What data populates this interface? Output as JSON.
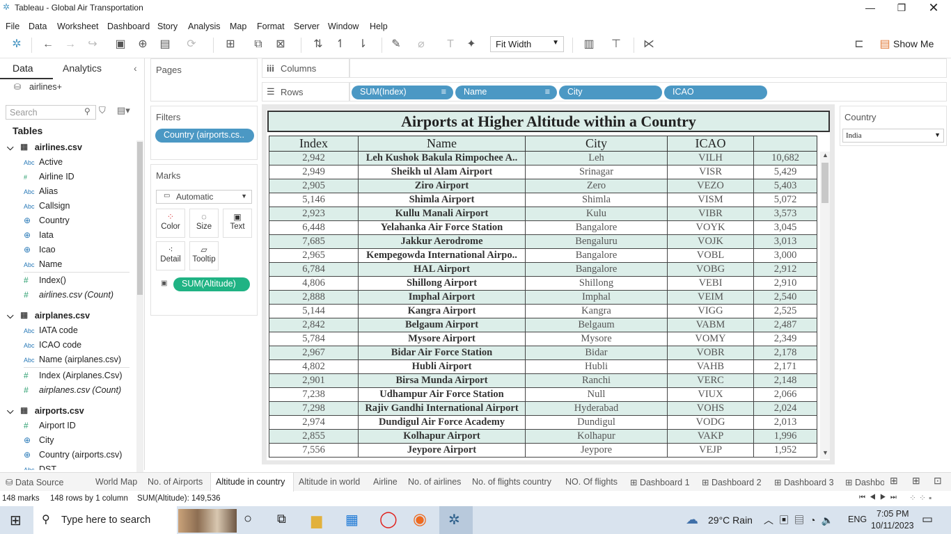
{
  "window": {
    "title": "Tableau - Global Air Transportation"
  },
  "menu": [
    "File",
    "Data",
    "Worksheet",
    "Dashboard",
    "Story",
    "Analysis",
    "Map",
    "Format",
    "Server",
    "Window",
    "Help"
  ],
  "toolbar": {
    "fit": "Fit Width",
    "show_me": "Show Me"
  },
  "left": {
    "tab_data": "Data",
    "tab_analytics": "Analytics",
    "datasource": "airlines+",
    "search_placeholder": "Search",
    "tables_label": "Tables",
    "airlines": {
      "name": "airlines.csv",
      "fields": [
        {
          "t": "Abc",
          "n": "Active"
        },
        {
          "t": "#",
          "n": "Airline ID"
        },
        {
          "t": "Abc",
          "n": "Alias"
        },
        {
          "t": "Abc",
          "n": "Callsign"
        },
        {
          "t": "globe",
          "n": "Country"
        },
        {
          "t": "globe",
          "n": "Iata"
        },
        {
          "t": "globe",
          "n": "Icao"
        },
        {
          "t": "Abc",
          "n": "Name"
        },
        {
          "t": "#",
          "n": "Index()"
        },
        {
          "t": "#",
          "n": "airlines.csv (Count)"
        }
      ]
    },
    "airplanes": {
      "name": "airplanes.csv",
      "fields": [
        {
          "t": "Abc",
          "n": "IATA code"
        },
        {
          "t": "Abc",
          "n": "ICAO code"
        },
        {
          "t": "Abc",
          "n": "Name (airplanes.csv)"
        },
        {
          "t": "#",
          "n": "Index (Airplanes.Csv)"
        },
        {
          "t": "#",
          "n": "airplanes.csv (Count)"
        }
      ]
    },
    "airports": {
      "name": "airports.csv",
      "fields": [
        {
          "t": "#",
          "n": "Airport ID"
        },
        {
          "t": "globe",
          "n": "City"
        },
        {
          "t": "globe",
          "n": "Country (airports.csv)"
        },
        {
          "t": "Abc",
          "n": "DST"
        }
      ]
    }
  },
  "pages_label": "Pages",
  "filters_label": "Filters",
  "filter_pill": "Country (airports.cs..",
  "marks_label": "Marks",
  "marks_type": "Automatic",
  "marks": {
    "color": "Color",
    "size": "Size",
    "text": "Text",
    "detail": "Detail",
    "tooltip": "Tooltip",
    "measure": "SUM(Altitude)"
  },
  "columns_label": "Columns",
  "rows_label": "Rows",
  "rows_pills": [
    "SUM(Index)",
    "Name",
    "City",
    "ICAO"
  ],
  "viz": {
    "title": "Airports at Higher Altitude within a Country",
    "headers": [
      "Index",
      "Name",
      "City",
      "ICAO",
      ""
    ],
    "rows": [
      [
        "2,942",
        "Leh Kushok Bakula Rimpochee A..",
        "Leh",
        "VILH",
        "10,682"
      ],
      [
        "2,949",
        "Sheikh ul Alam Airport",
        "Srinagar",
        "VISR",
        "5,429"
      ],
      [
        "2,905",
        "Ziro Airport",
        "Zero",
        "VEZO",
        "5,403"
      ],
      [
        "5,146",
        "Shimla Airport",
        "Shimla",
        "VISM",
        "5,072"
      ],
      [
        "2,923",
        "Kullu Manali Airport",
        "Kulu",
        "VIBR",
        "3,573"
      ],
      [
        "6,448",
        "Yelahanka Air Force Station",
        "Bangalore",
        "VOYK",
        "3,045"
      ],
      [
        "7,685",
        "Jakkur Aerodrome",
        "Bengaluru",
        "VOJK",
        "3,013"
      ],
      [
        "2,965",
        "Kempegowda International Airpo..",
        "Bangalore",
        "VOBL",
        "3,000"
      ],
      [
        "6,784",
        "HAL Airport",
        "Bangalore",
        "VOBG",
        "2,912"
      ],
      [
        "4,806",
        "Shillong Airport",
        "Shillong",
        "VEBI",
        "2,910"
      ],
      [
        "2,888",
        "Imphal Airport",
        "Imphal",
        "VEIM",
        "2,540"
      ],
      [
        "5,144",
        "Kangra Airport",
        "Kangra",
        "VIGG",
        "2,525"
      ],
      [
        "2,842",
        "Belgaum Airport",
        "Belgaum",
        "VABM",
        "2,487"
      ],
      [
        "5,784",
        "Mysore Airport",
        "Mysore",
        "VOMY",
        "2,349"
      ],
      [
        "2,967",
        "Bidar Air Force Station",
        "Bidar",
        "VOBR",
        "2,178"
      ],
      [
        "4,802",
        "Hubli Airport",
        "Hubli",
        "VAHB",
        "2,171"
      ],
      [
        "2,901",
        "Birsa Munda Airport",
        "Ranchi",
        "VERC",
        "2,148"
      ],
      [
        "7,238",
        "Udhampur Air Force Station",
        "Null",
        "VIUX",
        "2,066"
      ],
      [
        "7,298",
        "Rajiv Gandhi International Airport",
        "Hyderabad",
        "VOHS",
        "2,024"
      ],
      [
        "2,974",
        "Dundigul Air Force Academy",
        "Dundigul",
        "VODG",
        "2,013"
      ],
      [
        "2,855",
        "Kolhapur Airport",
        "Kolhapur",
        "VAKP",
        "1,996"
      ],
      [
        "7,556",
        "Jeypore Airport",
        "Jeypore",
        "VEJP",
        "1,952"
      ]
    ]
  },
  "country_filter": {
    "label": "Country",
    "value": "India"
  },
  "sheets": [
    "Data Source",
    "World Map",
    "No. of Airports",
    "Altitude in country",
    "Altitude in world",
    "Airline",
    "No. of airlines",
    "No. of flights country",
    "NO. Of flights",
    "Dashboard 1",
    "Dashboard 2",
    "Dashboard 3",
    "Dashbo"
  ],
  "status": {
    "marks": "148 marks",
    "rows": "148 rows by 1 column",
    "sum": "SUM(Altitude): 149,536"
  },
  "taskbar": {
    "search": "Type here to search",
    "weather": "29°C  Rain",
    "lang": "ENG",
    "time": "7:05 PM",
    "date": "10/11/2023"
  }
}
